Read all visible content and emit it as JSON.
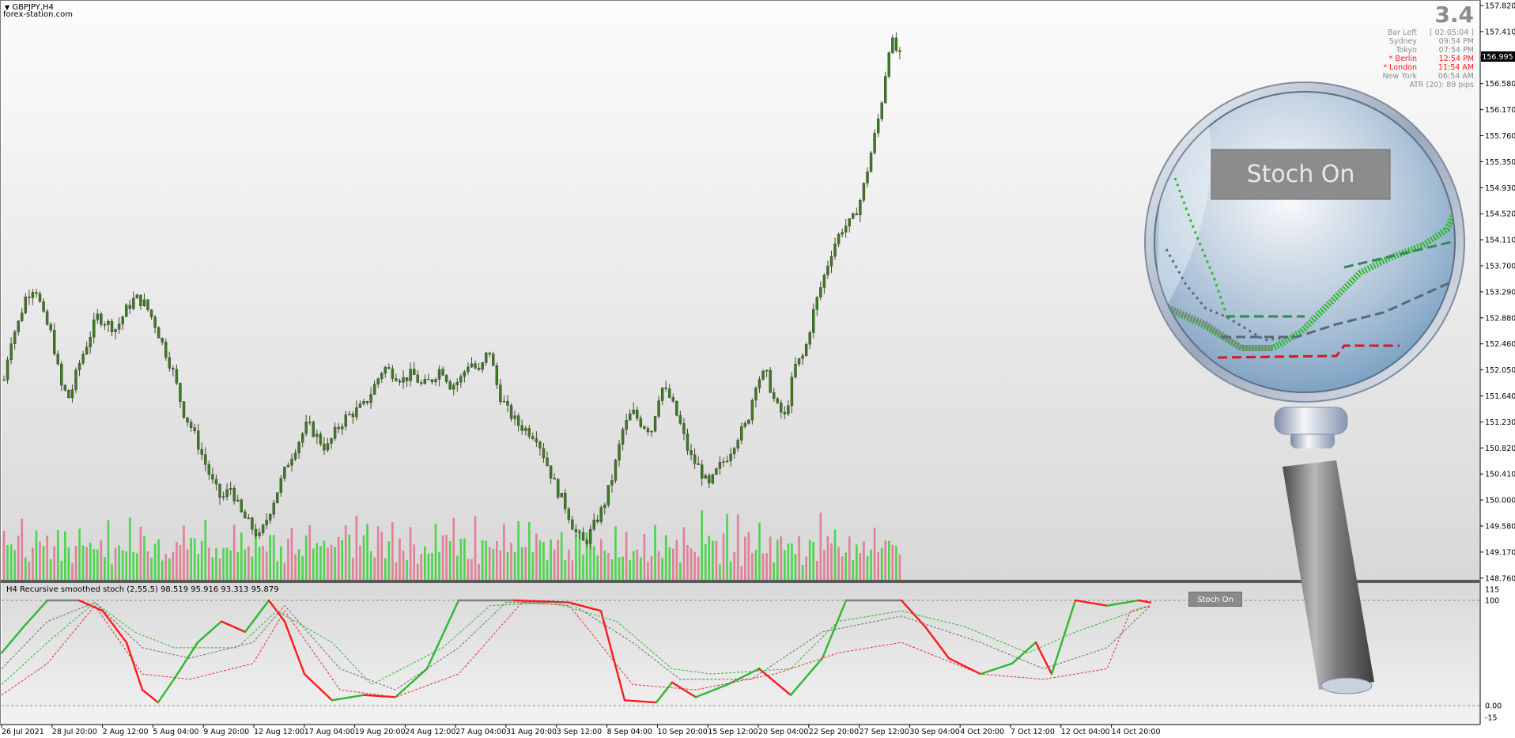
{
  "window": {
    "symbol": "GBPJPY,H4",
    "watermark": "forex-station.com"
  },
  "price_axis": {
    "labels": [
      "157.820",
      "157.410",
      "157.000",
      "156.580",
      "156.170",
      "155.760",
      "155.350",
      "154.930",
      "154.520",
      "154.110",
      "153.700",
      "153.290",
      "152.880",
      "152.460",
      "152.050",
      "151.640",
      "151.230",
      "150.820",
      "150.410",
      "150.000",
      "149.580",
      "149.170",
      "148.760"
    ],
    "current_price": "156.995"
  },
  "indicator_axis": {
    "labels": [
      "115",
      "100",
      "0.00",
      "-15"
    ]
  },
  "time_axis": {
    "labels": [
      "26 Jul 2021",
      "28 Jul 20:00",
      "2 Aug 12:00",
      "5 Aug 04:00",
      "9 Aug 20:00",
      "12 Aug 12:00",
      "17 Aug 04:00",
      "19 Aug 20:00",
      "24 Aug 12:00",
      "27 Aug 04:00",
      "31 Aug 20:00",
      "3 Sep 12:00",
      "8 Sep 04:00",
      "10 Sep 20:00",
      "15 Sep 12:00",
      "20 Sep 04:00",
      "22 Sep 20:00",
      "27 Sep 12:00",
      "30 Sep 04:00",
      "4 Oct 20:00",
      "7 Oct 12:00",
      "12 Oct 04:00",
      "14 Oct 20:00"
    ]
  },
  "clock_panel": {
    "version": "3.4",
    "rows": [
      {
        "city": "Bar Left",
        "time": "[ 02:05:04 ]",
        "highlight": false
      },
      {
        "city": "Sydney",
        "time": "09:54 PM",
        "highlight": false
      },
      {
        "city": "Tokyo",
        "time": "07:54 PM",
        "highlight": false
      },
      {
        "city": "* Berlin",
        "time": "12:54 PM",
        "highlight": true
      },
      {
        "city": "* London",
        "time": "11:54 AM",
        "highlight": true
      },
      {
        "city": "New York",
        "time": "06:54 AM",
        "highlight": false
      }
    ],
    "atr": "ATR (20): 89 pips"
  },
  "indicator": {
    "title": "H4  Recursive smoothed stoch (2,55,5) 98.519 95.916 93.313 95.879",
    "button_label": "Stoch On",
    "zoom_button_label": "Stoch On"
  },
  "colors": {
    "bull": "#2db82d",
    "bear": "#ff1a1a",
    "neutral": "#808080",
    "volume_bull": "#32d232",
    "volume_bear": "#e0708a",
    "candle_body": "#3a7d1e",
    "candle_wick": "#4a4a2a"
  },
  "chart_data": {
    "type": "candlestick",
    "close_path": [
      [
        0,
        151.9
      ],
      [
        5,
        152.5
      ],
      [
        12,
        152.8
      ],
      [
        18,
        153.2
      ],
      [
        26,
        153.4
      ],
      [
        33,
        152.9
      ],
      [
        40,
        152.6
      ],
      [
        48,
        151.8
      ],
      [
        55,
        151.6
      ],
      [
        62,
        152.1
      ],
      [
        70,
        152.5
      ],
      [
        78,
        152.9
      ],
      [
        86,
        152.8
      ],
      [
        94,
        152.7
      ],
      [
        102,
        153.0
      ],
      [
        110,
        153.2
      ],
      [
        118,
        153.1
      ],
      [
        126,
        152.8
      ],
      [
        134,
        152.4
      ],
      [
        142,
        152.0
      ],
      [
        150,
        151.4
      ],
      [
        158,
        151.1
      ],
      [
        166,
        150.7
      ],
      [
        174,
        150.3
      ],
      [
        182,
        150.0
      ],
      [
        190,
        150.2
      ],
      [
        198,
        149.8
      ],
      [
        206,
        149.6
      ],
      [
        214,
        149.4
      ],
      [
        222,
        149.8
      ],
      [
        230,
        150.2
      ],
      [
        238,
        150.6
      ],
      [
        246,
        150.9
      ],
      [
        254,
        151.2
      ],
      [
        262,
        151.0
      ],
      [
        270,
        150.8
      ],
      [
        278,
        151.1
      ],
      [
        286,
        151.3
      ],
      [
        294,
        151.4
      ],
      [
        302,
        151.5
      ],
      [
        310,
        151.8
      ],
      [
        318,
        152.1
      ],
      [
        326,
        152.0
      ],
      [
        334,
        151.9
      ],
      [
        342,
        152.0
      ],
      [
        350,
        151.8
      ],
      [
        358,
        151.9
      ],
      [
        366,
        152.1
      ],
      [
        374,
        151.8
      ],
      [
        382,
        151.9
      ],
      [
        390,
        152.2
      ],
      [
        398,
        152.0
      ],
      [
        406,
        152.4
      ],
      [
        414,
        151.7
      ],
      [
        422,
        151.4
      ],
      [
        430,
        151.2
      ],
      [
        438,
        151.1
      ],
      [
        446,
        151.0
      ],
      [
        454,
        150.6
      ],
      [
        462,
        150.2
      ],
      [
        470,
        149.9
      ],
      [
        478,
        149.5
      ],
      [
        486,
        149.3
      ],
      [
        494,
        149.6
      ],
      [
        502,
        149.9
      ],
      [
        510,
        150.4
      ],
      [
        518,
        151.1
      ],
      [
        526,
        151.4
      ],
      [
        534,
        151.2
      ],
      [
        542,
        151.1
      ],
      [
        550,
        151.8
      ],
      [
        558,
        151.6
      ],
      [
        566,
        151.2
      ],
      [
        574,
        150.7
      ],
      [
        582,
        150.5
      ],
      [
        590,
        150.2
      ],
      [
        598,
        150.5
      ],
      [
        606,
        150.7
      ],
      [
        614,
        151.0
      ],
      [
        622,
        151.2
      ],
      [
        630,
        151.9
      ],
      [
        638,
        152.0
      ],
      [
        646,
        151.5
      ],
      [
        654,
        151.3
      ],
      [
        662,
        152.1
      ],
      [
        670,
        152.3
      ],
      [
        678,
        153.0
      ],
      [
        686,
        153.5
      ],
      [
        694,
        154.0
      ],
      [
        702,
        154.3
      ],
      [
        710,
        154.4
      ],
      [
        718,
        154.8
      ],
      [
        726,
        155.5
      ],
      [
        734,
        156.2
      ],
      [
        742,
        157.3
      ],
      [
        750,
        157.0
      ]
    ],
    "volume_profile": [
      50,
      40,
      70,
      35,
      45,
      80,
      42,
      30,
      55,
      65,
      38,
      48,
      72,
      28,
      44,
      60,
      36,
      52,
      66,
      30,
      40,
      58,
      34,
      46,
      70,
      32,
      44,
      54,
      38,
      62,
      28,
      48,
      56,
      40,
      36,
      66,
      30,
      44,
      52,
      60,
      34,
      46,
      40,
      70,
      32,
      50,
      38,
      58,
      44,
      36,
      64,
      30,
      48,
      54,
      42,
      38,
      60,
      34,
      46,
      52,
      40,
      56,
      36,
      44,
      62,
      30,
      48,
      58,
      38,
      42,
      66,
      34,
      50,
      40,
      56,
      46,
      36,
      60,
      32,
      44,
      52,
      40,
      64,
      38,
      48,
      54,
      42,
      36,
      70,
      40,
      58,
      46,
      34,
      52,
      44,
      62
    ]
  }
}
